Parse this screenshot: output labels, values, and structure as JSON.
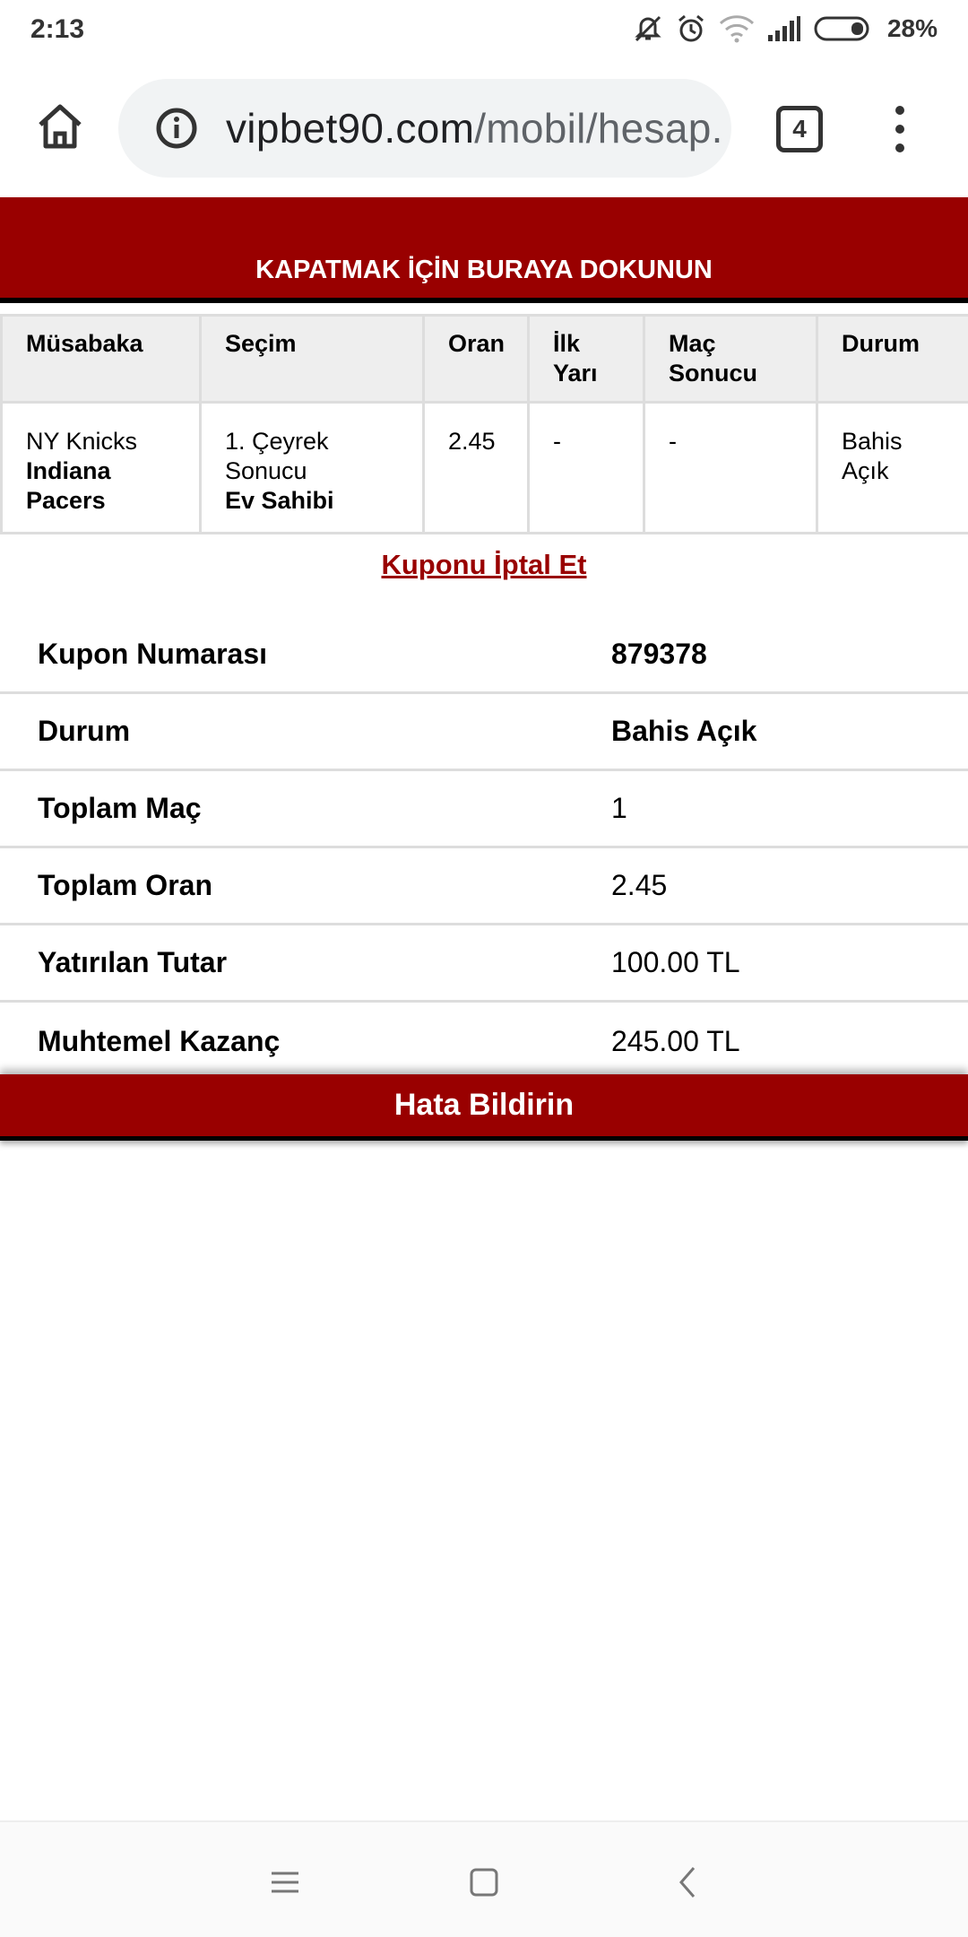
{
  "status_bar": {
    "time": "2:13",
    "battery": "28%",
    "icons": [
      "mute-icon",
      "alarm-icon",
      "wifi-icon",
      "signal-icon",
      "battery-icon"
    ]
  },
  "browser": {
    "url_domain": "vipbet90.com",
    "url_path": "/mobil/hesap.",
    "tab_count": "4"
  },
  "close_banner": "KAPATMAK İÇİN BURAYA DOKUNUN",
  "bet_table": {
    "headers": [
      "Müsabaka",
      "Seçim",
      "Oran",
      "İlk Yarı",
      "Maç Sonucu",
      "Durum"
    ],
    "row": {
      "team_home": "NY Knicks",
      "team_away": "Indiana Pacers",
      "selection_market": "1. Çeyrek Sonucu",
      "selection_pick": "Ev Sahibi",
      "odds": "2.45",
      "first_half": "-",
      "match_result": "-",
      "status": "Bahis Açık"
    }
  },
  "cancel_link": "Kuponu İptal Et",
  "summary": [
    {
      "label": "Kupon Numarası",
      "value": "879378"
    },
    {
      "label": "Durum",
      "value": "Bahis Açık"
    },
    {
      "label": "Toplam Maç",
      "value": "1"
    },
    {
      "label": "Toplam Oran",
      "value": "2.45"
    },
    {
      "label": "Yatırılan Tutar",
      "value": "100.00 TL"
    },
    {
      "label": "Muhtemel Kazanç",
      "value": "245.00 TL"
    }
  ],
  "error_banner": "Hata Bildirin",
  "colors": {
    "brand_red": "#990000",
    "header_bg": "#eeeeee",
    "border": "#dddddd"
  }
}
